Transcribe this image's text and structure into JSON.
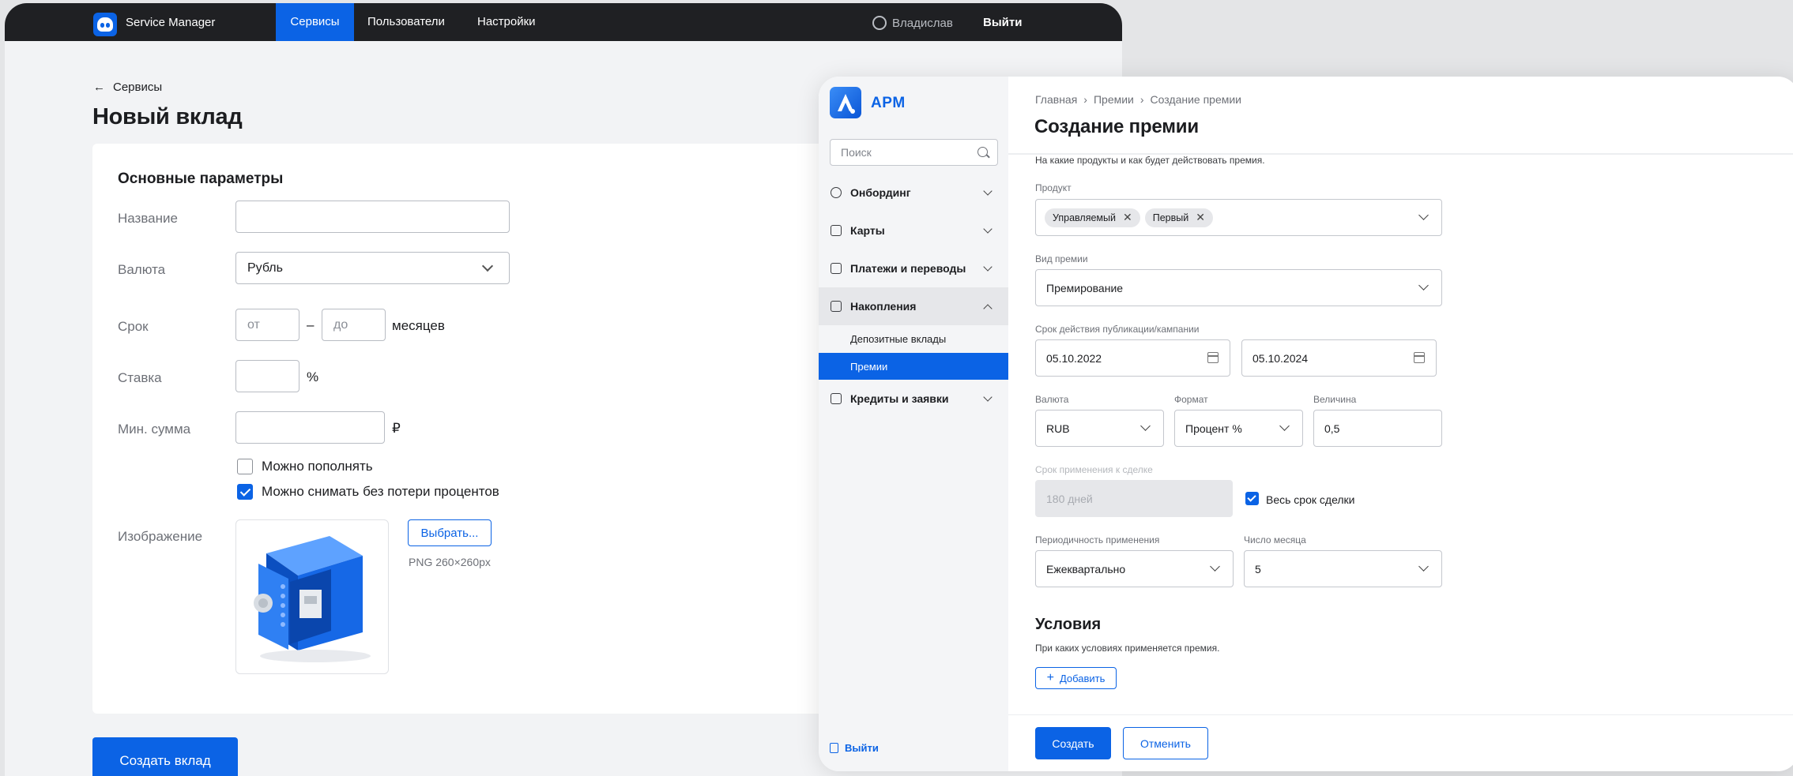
{
  "sm": {
    "brand": "Service Manager",
    "nav": [
      "Сервисы",
      "Пользователи",
      "Настройки"
    ],
    "user": "Владислав",
    "logout": "Выйти",
    "back": "Сервисы",
    "title": "Новый вклад",
    "section": "Основные параметры",
    "labels": {
      "name": "Название",
      "currency": "Валюта",
      "term": "Срок",
      "rate": "Ставка",
      "min_sum": "Мин. сумма",
      "image": "Изображение"
    },
    "currency_value": "Рубль",
    "term_from_placeholder": "от",
    "term_dash": "–",
    "term_to_placeholder": "до",
    "term_unit": "месяцев",
    "rate_unit": "%",
    "sum_unit": "₽",
    "checkboxes": [
      {
        "label": "Можно пополнять",
        "checked": false
      },
      {
        "label": "Можно снимать без потери процентов",
        "checked": true
      }
    ],
    "choose_button": "Выбрать...",
    "image_hint": "PNG 260×260px",
    "create_button": "Создать вклад",
    "accent": "#0b63e5"
  },
  "apm": {
    "brand": "APM",
    "search_placeholder": "Поиск",
    "sidebar": [
      {
        "label": "Онбординг",
        "icon": "user-icon",
        "expanded": false
      },
      {
        "label": "Карты",
        "icon": "card-icon",
        "expanded": false
      },
      {
        "label": "Платежи и переводы",
        "icon": "payment-icon",
        "expanded": false
      },
      {
        "label": "Накопления",
        "icon": "savings-icon",
        "expanded": true
      },
      {
        "label": "Кредиты и заявки",
        "icon": "credit-icon",
        "expanded": false
      }
    ],
    "subitems": [
      "Депозитные вклады",
      "Премии"
    ],
    "logout": "Выйти",
    "breadcrumbs": [
      "Главная",
      "Премии",
      "Создание премии"
    ],
    "title": "Создание премии",
    "description": "На какие продукты и как будет действовать премия.",
    "product_label": "Продукт",
    "product_tags": [
      "Управляемый",
      "Первый"
    ],
    "bonus_type_label": "Вид премии",
    "bonus_type_value": "Премирование",
    "period_label": "Срок действия публикации/кампании",
    "date_from": "05.10.2022",
    "date_to": "05.10.2024",
    "currency_label": "Валюта",
    "currency_value": "RUB",
    "format_label": "Формат",
    "format_value": "Процент %",
    "amount_label": "Величина",
    "amount_value": "0,5",
    "apply_term_label": "Срок применения к сделке",
    "apply_term_value": "180 дней",
    "whole_term_label": "Весь срок сделки",
    "periodicity_label": "Периодичность применения",
    "periodicity_value": "Ежеквартально",
    "day_label": "Число месяца",
    "day_value": "5",
    "conditions_title": "Условия",
    "conditions_desc": "При каких условиях применяется премия.",
    "add_button": "Добавить",
    "create_button": "Создать",
    "cancel_button": "Отменить"
  }
}
